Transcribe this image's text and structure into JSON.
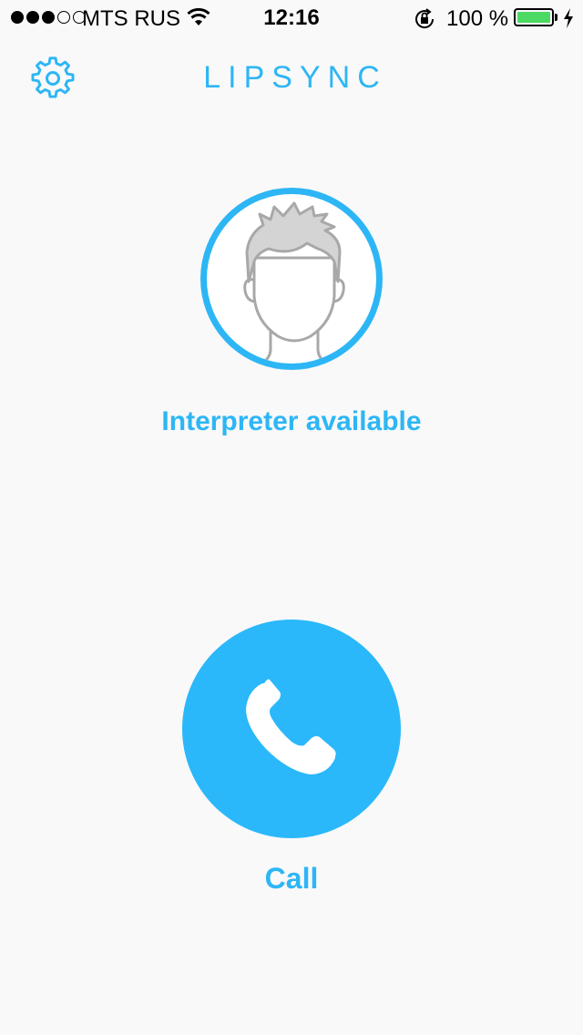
{
  "status_bar": {
    "signal_filled": 3,
    "signal_total": 5,
    "carrier": "MTS RUS",
    "time": "12:16",
    "battery_text": "100 %",
    "battery_level": 1.0,
    "icons": [
      "wifi-icon",
      "orientation-lock-icon",
      "battery-icon",
      "charging-bolt-icon"
    ]
  },
  "nav": {
    "title": "LIPSYNC",
    "settings_icon": "gear-icon"
  },
  "interpreter": {
    "avatar_icon": "person-avatar-icon",
    "status": "Interpreter available"
  },
  "call": {
    "icon": "phone-icon",
    "label": "Call"
  },
  "colors": {
    "accent": "#2db6f5",
    "call_button": "#2ab8fb",
    "background": "#f9f9f9",
    "battery": "#4cd964",
    "avatar_line": "#a8a8a8",
    "avatar_hair": "#d4d4d4"
  }
}
